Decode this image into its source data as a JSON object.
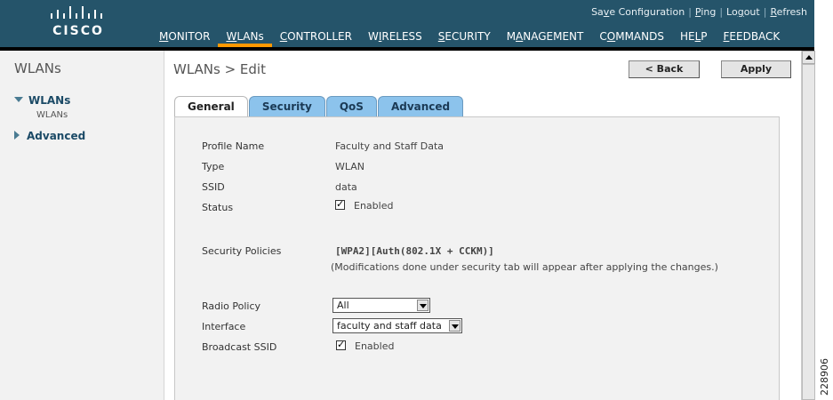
{
  "brand": {
    "logo_text": "CISCO",
    "color": "#25546a",
    "accent": "#ff9900"
  },
  "utility_links": [
    "Save Configuration",
    "Ping",
    "Logout",
    "Refresh"
  ],
  "main_nav": [
    {
      "label": "MONITOR",
      "ul": "M",
      "rest": "ONITOR"
    },
    {
      "label": "WLANs",
      "ul": "W",
      "rest": "LANs",
      "active": true
    },
    {
      "label": "CONTROLLER",
      "ul": "C",
      "rest": "ONTROLLER"
    },
    {
      "label": "WIRELESS",
      "pre": "W",
      "ul": "I",
      "rest": "RELESS"
    },
    {
      "label": "SECURITY",
      "ul": "S",
      "rest": "ECURITY"
    },
    {
      "label": "MANAGEMENT",
      "pre": "M",
      "ul": "A",
      "rest": "NAGEMENT"
    },
    {
      "label": "COMMANDS",
      "pre": "C",
      "ul": "O",
      "rest": "MMANDS"
    },
    {
      "label": "HELP",
      "pre": "HE",
      "ul": "L",
      "rest": "P"
    },
    {
      "label": "FEEDBACK",
      "ul": "F",
      "rest": "EEDBACK"
    }
  ],
  "sidebar": {
    "title": "WLANs",
    "items": [
      {
        "label": "WLANs",
        "expanded": true,
        "sub": "WLANs"
      },
      {
        "label": "Advanced",
        "expanded": false
      }
    ]
  },
  "page": {
    "title": "WLANs > Edit",
    "back_label": "< Back",
    "apply_label": "Apply"
  },
  "tabs": [
    "General",
    "Security",
    "QoS",
    "Advanced"
  ],
  "general": {
    "profile_name_label": "Profile Name",
    "profile_name": "Faculty and Staff Data",
    "type_label": "Type",
    "type": "WLAN",
    "ssid_label": "SSID",
    "ssid": "data",
    "status_label": "Status",
    "status_text": "Enabled",
    "security_label": "Security Policies",
    "security_value": "[WPA2][Auth(802.1X + CCKM)]",
    "security_note": "(Modifications done under security tab will appear after applying the changes.)",
    "radio_policy_label": "Radio Policy",
    "radio_policy": "All",
    "interface_label": "Interface",
    "interface": "faculty and staff data",
    "broadcast_label": "Broadcast SSID",
    "broadcast_text": "Enabled"
  },
  "figure_id": "228906"
}
